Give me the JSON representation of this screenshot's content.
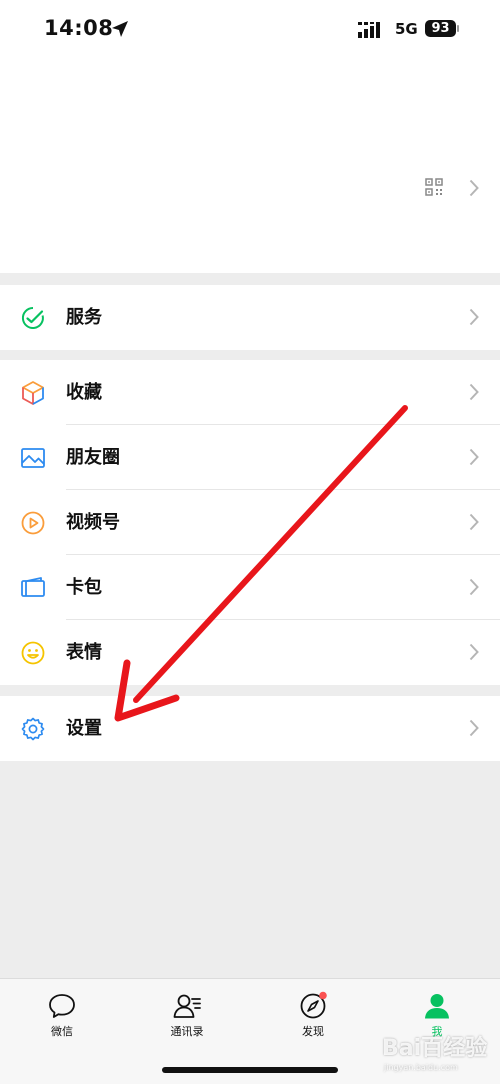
{
  "status_bar": {
    "time": "14:08",
    "network": "5G",
    "battery": "93"
  },
  "menu_groups": [
    [
      {
        "label": "服务",
        "icon": "service-icon"
      }
    ],
    [
      {
        "label": "收藏",
        "icon": "favorites-icon"
      },
      {
        "label": "朋友圈",
        "icon": "moments-icon"
      },
      {
        "label": "视频号",
        "icon": "channels-icon"
      },
      {
        "label": "卡包",
        "icon": "card-wallet-icon"
      },
      {
        "label": "表情",
        "icon": "stickers-icon"
      }
    ],
    [
      {
        "label": "设置",
        "icon": "settings-icon"
      }
    ]
  ],
  "tabs": [
    {
      "label": "微信",
      "icon": "chat-icon",
      "active": false
    },
    {
      "label": "通讯录",
      "icon": "contacts-icon",
      "active": false
    },
    {
      "label": "发现",
      "icon": "discover-icon",
      "active": false,
      "badge_dot": true
    },
    {
      "label": "我",
      "icon": "me-icon",
      "active": true
    }
  ],
  "watermark": {
    "main": "Bai百经验",
    "sub": "jingyan.baidu.com"
  },
  "colors": {
    "accent_green": "#07c160",
    "arrow_red": "#e8161b",
    "badge_red": "#fa5151"
  }
}
